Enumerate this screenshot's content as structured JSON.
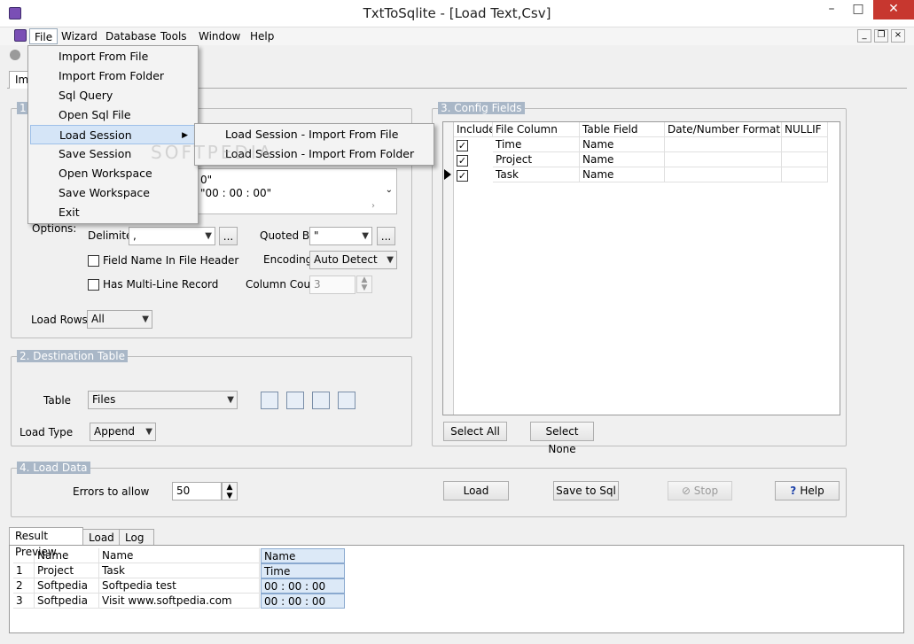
{
  "window": {
    "title": "TxtToSqlite - [Load Text,Csv]"
  },
  "menubar": {
    "items": [
      "File",
      "Wizard",
      "Database",
      "Tools",
      "Window",
      "Help"
    ]
  },
  "file_menu": {
    "items": [
      "Import From File",
      "Import From Folder",
      "Sql Query",
      "Open Sql File",
      "Load Session",
      "Save Session",
      "Open Workspace",
      "Save Workspace",
      "Exit"
    ],
    "highlighted": "Load Session"
  },
  "load_session_submenu": {
    "items": [
      "Load Session - Import From File",
      "Load Session - Import From Folder"
    ]
  },
  "doc_tab": {
    "label": "Imp"
  },
  "source": {
    "legend": "1.",
    "preview_lines": [
      "0\"",
      "\"00 : 00 : 00\""
    ],
    "options_label": "Options:",
    "delimiter_label": "Delimiter",
    "delimiter_value": ",",
    "quoted_by_label": "Quoted By",
    "quoted_by_value": "\"",
    "field_name_header_label": "Field Name In File Header",
    "encoding_label": "Encoding",
    "encoding_value": "Auto Detect",
    "multiline_label": "Has Multi-Line Record",
    "column_count_label": "Column Count",
    "column_count_value": "3",
    "load_rows_label": "Load Rows",
    "load_rows_value": "All",
    "browse_label": "..."
  },
  "destination": {
    "legend": "2. Destination Table",
    "table_label": "Table",
    "table_value": "Files",
    "load_type_label": "Load Type",
    "load_type_value": "Append"
  },
  "config": {
    "legend": "3. Config Fields",
    "columns": [
      "Include",
      "File Column",
      "Table Field",
      "Date/Number Format",
      "NULLIF"
    ],
    "rows": [
      {
        "include": true,
        "file_column": "Time",
        "table_field": "Name"
      },
      {
        "include": true,
        "file_column": "Project",
        "table_field": "Name"
      },
      {
        "include": true,
        "file_column": "Task",
        "table_field": "Name"
      }
    ],
    "select_all": "Select All",
    "select_none": "Select None"
  },
  "load_data": {
    "legend": "4. Load Data",
    "errors_label": "Errors to allow",
    "errors_value": "50",
    "load": "Load",
    "save_to_sql": "Save to Sql",
    "stop": "Stop",
    "help": "Help"
  },
  "bottom_tabs": [
    "Result Preview",
    "Load",
    "Log"
  ],
  "preview": {
    "columns": [
      "Name",
      "Name",
      "Name"
    ],
    "rows": [
      {
        "n": "1",
        "c1": "Project",
        "c2": "Task",
        "c3": "Time"
      },
      {
        "n": "2",
        "c1": "Softpedia",
        "c2": "Softpedia test",
        "c3": "00 : 00 : 00"
      },
      {
        "n": "3",
        "c1": "Softpedia",
        "c2": "Visit www.softpedia.com",
        "c3": "00 : 00 : 00"
      }
    ]
  },
  "watermark": {
    "text": "SOFTPEDIA"
  }
}
